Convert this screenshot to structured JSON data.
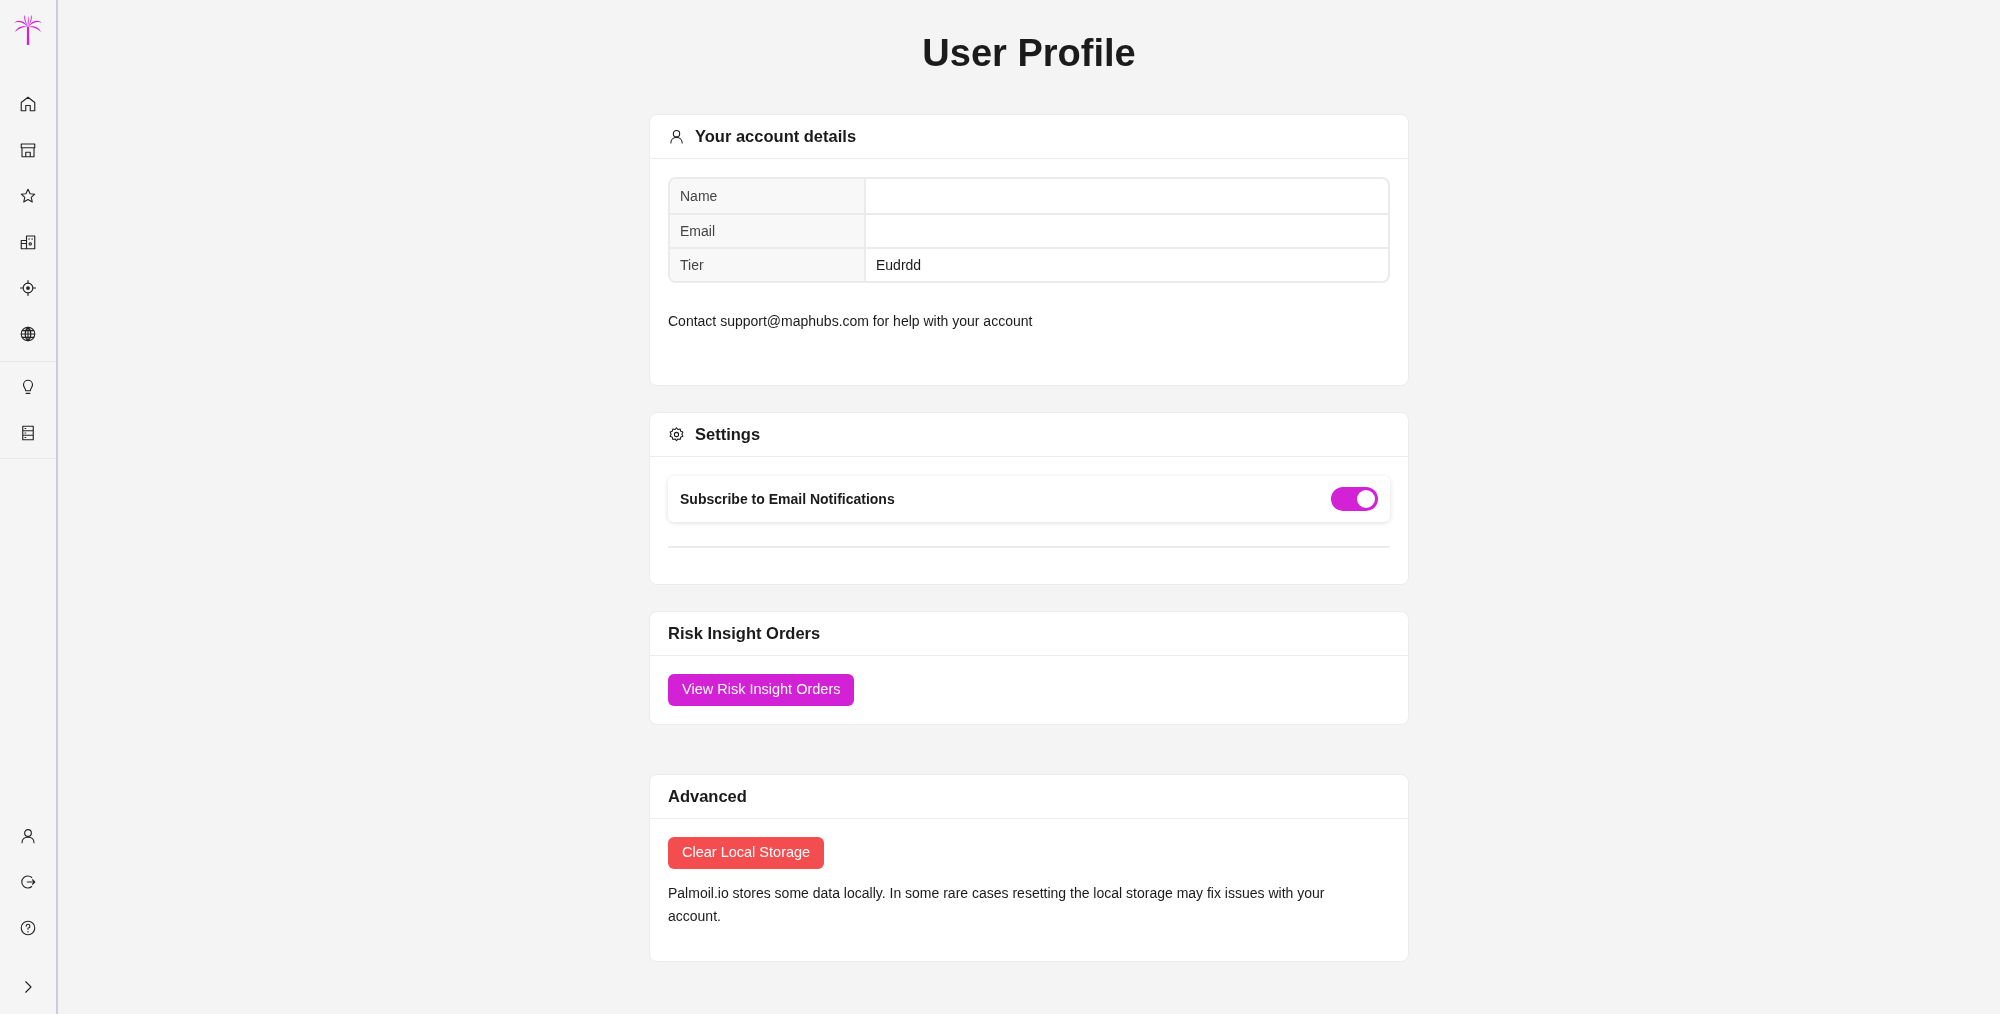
{
  "page": {
    "title": "User Profile"
  },
  "account_card": {
    "title": "Your account details",
    "rows": [
      {
        "label": "Name"
      },
      {
        "label": "Email"
      },
      {
        "label": "Tier",
        "value": "Eudrdd"
      }
    ],
    "contact_note": "Contact support@maphubs.com for help with your account"
  },
  "settings_card": {
    "title": "Settings",
    "options": [
      {
        "label": "Subscribe to Email Notifications",
        "on": true
      }
    ]
  },
  "risk_card": {
    "title": "Risk Insight Orders",
    "button": "View Risk Insight Orders"
  },
  "advanced_card": {
    "title": "Advanced",
    "button": "Clear Local Storage",
    "note": "Palmoil.io stores some data locally. In some rare cases resetting the local storage may fix issues with your account."
  }
}
